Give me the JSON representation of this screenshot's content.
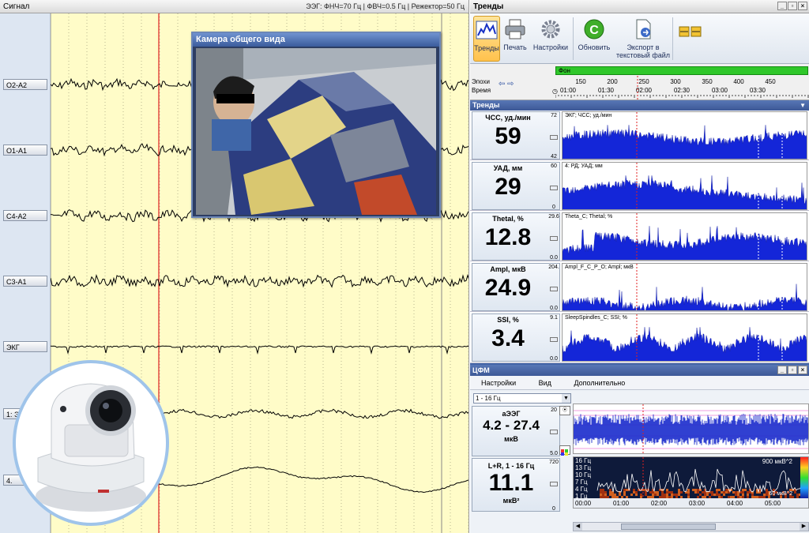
{
  "signal": {
    "title": "Сигнал",
    "filters": "ЭЭГ: ФНЧ=70 Гц | ФВЧ=0.5 Гц | Режектор=50 Гц",
    "channels": [
      "O2-A2",
      "O1-A1",
      "C4-A2",
      "C3-A1",
      "ЭКГ",
      "1: Э",
      "4."
    ]
  },
  "camera": {
    "title": "Камера общего вида"
  },
  "trends": {
    "window_title": "Тренды",
    "ribbon": {
      "trends": "Тренды",
      "print": "Печать",
      "settings": "Настройки",
      "refresh": "Обновить",
      "export": "Экспорт в текстовый файл"
    },
    "fon": "Фон",
    "epochs_label": "Эпохи",
    "time_label": "Время",
    "epoch_ticks": [
      "150",
      "200",
      "250",
      "300",
      "350",
      "400",
      "450"
    ],
    "time_ticks": [
      "01:00",
      "01:30",
      "02:00",
      "02:30",
      "03:00",
      "03:30"
    ],
    "section_title": "Тренды",
    "rows": [
      {
        "name": "ЧСС, уд./мин",
        "value": "59",
        "max": "72",
        "min": "42",
        "graph_label": "ЭКГ; ЧСС; уд./мин"
      },
      {
        "name": "УАД, мм",
        "value": "29",
        "max": "60",
        "min": "0",
        "graph_label": "4: РД; УАД; мм"
      },
      {
        "name": "Thetal, %",
        "value": "12.8",
        "max": "29.6",
        "min": "0.0",
        "graph_label": "Theta_C; Thetal; %"
      },
      {
        "name": "Ampl, мкВ",
        "value": "24.9",
        "max": "204.",
        "min": "0.0",
        "graph_label": "Ampl_F_C_P_O; Ampl; мкВ"
      },
      {
        "name": "SSI, %",
        "value": "3.4",
        "max": "9.1",
        "min": "0.0",
        "graph_label": "SleepSpindles_C; SSI; %"
      }
    ]
  },
  "cfm": {
    "title": "ЦФМ",
    "menu": [
      "Настройки",
      "Вид",
      "Дополнительно"
    ],
    "select": "1 - 16 Гц",
    "aeeg": {
      "name": "аЭЭГ",
      "value": "4.2 - 27.4",
      "unit": "мкВ",
      "max": "20",
      "min": "5.0"
    },
    "lr": {
      "name": "L+R, 1 - 16 Гц",
      "value": "11.1",
      "unit": "мкВ²",
      "max": "720",
      "min": "0"
    },
    "spectrum_labels": [
      "16 Гц",
      "13 Гц",
      "10 Гц",
      "7 Гц",
      "4 Гц",
      "1 Гц"
    ],
    "spectrum_max": "900 мкВ^2",
    "spectrum_corner": "60 мкВ^2",
    "time_ticks": [
      "00:00",
      "01:00",
      "02:00",
      "03:00",
      "04:00",
      "05:00"
    ],
    "aeeg_ticks": [
      "100",
      "50",
      "25",
      "10",
      "5"
    ]
  }
}
